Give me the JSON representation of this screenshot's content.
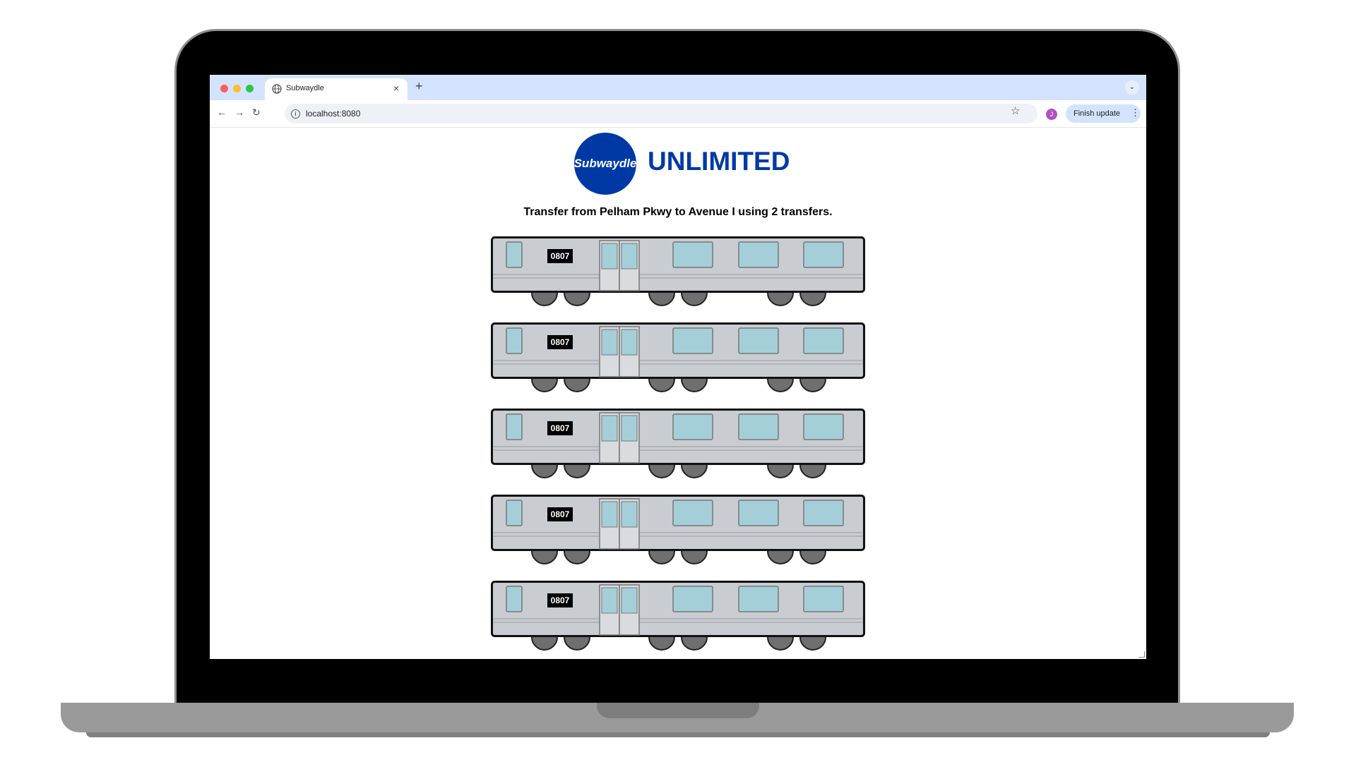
{
  "browser": {
    "tab_title": "Subwaydle",
    "tab_close": "×",
    "new_tab": "+",
    "tab_menu": "⌄",
    "back": "←",
    "forward": "→",
    "reload": "↻",
    "info_symbol": "i",
    "url": "localhost:8080",
    "bookmark_star": "☆",
    "avatar_initial": "J",
    "finish_update_label": "Finish update",
    "menu_dots": "⋮"
  },
  "page": {
    "logo_text": "Subwaydle",
    "title": "UNLIMITED",
    "instruction": "Transfer from Pelham Pkwy to Avenue I using 2 transfers.",
    "cars": [
      {
        "number": "0807"
      },
      {
        "number": "0807"
      },
      {
        "number": "0807"
      },
      {
        "number": "0807"
      },
      {
        "number": "0807"
      }
    ]
  },
  "colors": {
    "brand_blue": "#0039a6",
    "car_body": "#c9ccd1",
    "car_window": "#a5cfd8",
    "tab_bar": "#d3e3fd"
  }
}
